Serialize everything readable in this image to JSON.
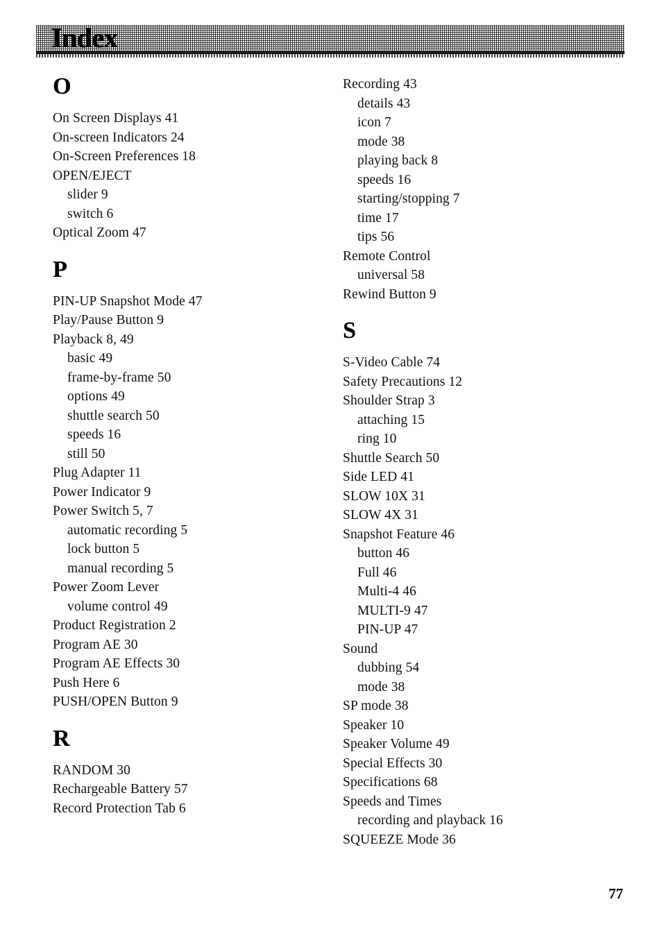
{
  "page": {
    "header_title": "Index",
    "page_number": "77",
    "ink_color": "#000000",
    "paper_color": "#ffffff",
    "header_band_color": "#9a9a9a"
  },
  "columns": {
    "left": [
      {
        "letter": "O",
        "entries": [
          {
            "text": "On Screen Displays  41",
            "level": 0
          },
          {
            "text": "On-screen Indicators  24",
            "level": 0
          },
          {
            "text": "On-Screen Preferences  18",
            "level": 0
          },
          {
            "text": "OPEN/EJECT",
            "level": 0
          },
          {
            "text": "slider  9",
            "level": 1
          },
          {
            "text": "switch  6",
            "level": 1
          },
          {
            "text": "Optical Zoom  47",
            "level": 0
          }
        ]
      },
      {
        "letter": "P",
        "entries": [
          {
            "text": "PIN-UP Snapshot Mode  47",
            "level": 0
          },
          {
            "text": "Play/Pause Button  9",
            "level": 0
          },
          {
            "text": "Playback  8, 49",
            "level": 0
          },
          {
            "text": "basic  49",
            "level": 1
          },
          {
            "text": "frame-by-frame  50",
            "level": 1
          },
          {
            "text": "options  49",
            "level": 1
          },
          {
            "text": "shuttle search  50",
            "level": 1
          },
          {
            "text": "speeds  16",
            "level": 1
          },
          {
            "text": "still  50",
            "level": 1
          },
          {
            "text": "Plug Adapter  11",
            "level": 0
          },
          {
            "text": "Power Indicator  9",
            "level": 0
          },
          {
            "text": "Power Switch  5, 7",
            "level": 0
          },
          {
            "text": "automatic recording  5",
            "level": 1
          },
          {
            "text": "lock button  5",
            "level": 1
          },
          {
            "text": "manual recording  5",
            "level": 1
          },
          {
            "text": "Power Zoom Lever",
            "level": 0
          },
          {
            "text": "volume control  49",
            "level": 1
          },
          {
            "text": "Product Registration  2",
            "level": 0
          },
          {
            "text": "Program AE  30",
            "level": 0
          },
          {
            "text": "Program AE Effects  30",
            "level": 0
          },
          {
            "text": "Push Here  6",
            "level": 0
          },
          {
            "text": "PUSH/OPEN Button  9",
            "level": 0
          }
        ]
      },
      {
        "letter": "R",
        "entries": [
          {
            "text": "RANDOM  30",
            "level": 0
          },
          {
            "text": "Rechargeable Battery  57",
            "level": 0
          },
          {
            "text": "Record Protection Tab  6",
            "level": 0
          }
        ]
      }
    ],
    "right": [
      {
        "letter": "",
        "entries": [
          {
            "text": "Recording  43",
            "level": 0
          },
          {
            "text": "details  43",
            "level": 1
          },
          {
            "text": "icon  7",
            "level": 1
          },
          {
            "text": "mode  38",
            "level": 1
          },
          {
            "text": "playing back  8",
            "level": 1
          },
          {
            "text": "speeds  16",
            "level": 1
          },
          {
            "text": "starting/stopping  7",
            "level": 1
          },
          {
            "text": "time  17",
            "level": 1
          },
          {
            "text": "tips  56",
            "level": 1
          },
          {
            "text": "Remote Control",
            "level": 0
          },
          {
            "text": "universal  58",
            "level": 1
          },
          {
            "text": "Rewind Button  9",
            "level": 0
          }
        ]
      },
      {
        "letter": "S",
        "entries": [
          {
            "text": "S-Video Cable  74",
            "level": 0
          },
          {
            "text": "Safety Precautions  12",
            "level": 0
          },
          {
            "text": "Shoulder Strap  3",
            "level": 0
          },
          {
            "text": "attaching  15",
            "level": 1
          },
          {
            "text": "ring  10",
            "level": 1
          },
          {
            "text": "Shuttle Search  50",
            "level": 0
          },
          {
            "text": "Side LED  41",
            "level": 0
          },
          {
            "text": "SLOW 10X  31",
            "level": 0
          },
          {
            "text": "SLOW 4X  31",
            "level": 0
          },
          {
            "text": "Snapshot Feature  46",
            "level": 0
          },
          {
            "text": "button  46",
            "level": 1
          },
          {
            "text": "Full  46",
            "level": 1
          },
          {
            "text": "Multi-4  46",
            "level": 1
          },
          {
            "text": "MULTI-9  47",
            "level": 1
          },
          {
            "text": "PIN-UP  47",
            "level": 1
          },
          {
            "text": "Sound",
            "level": 0
          },
          {
            "text": "dubbing  54",
            "level": 1
          },
          {
            "text": "mode  38",
            "level": 1
          },
          {
            "text": "SP mode  38",
            "level": 0
          },
          {
            "text": "Speaker  10",
            "level": 0
          },
          {
            "text": "Speaker Volume  49",
            "level": 0
          },
          {
            "text": "Special Effects  30",
            "level": 0
          },
          {
            "text": "Specifications  68",
            "level": 0
          },
          {
            "text": "Speeds and Times",
            "level": 0
          },
          {
            "text": "recording and playback  16",
            "level": 1
          },
          {
            "text": "SQUEEZE Mode  36",
            "level": 0
          }
        ]
      }
    ]
  }
}
